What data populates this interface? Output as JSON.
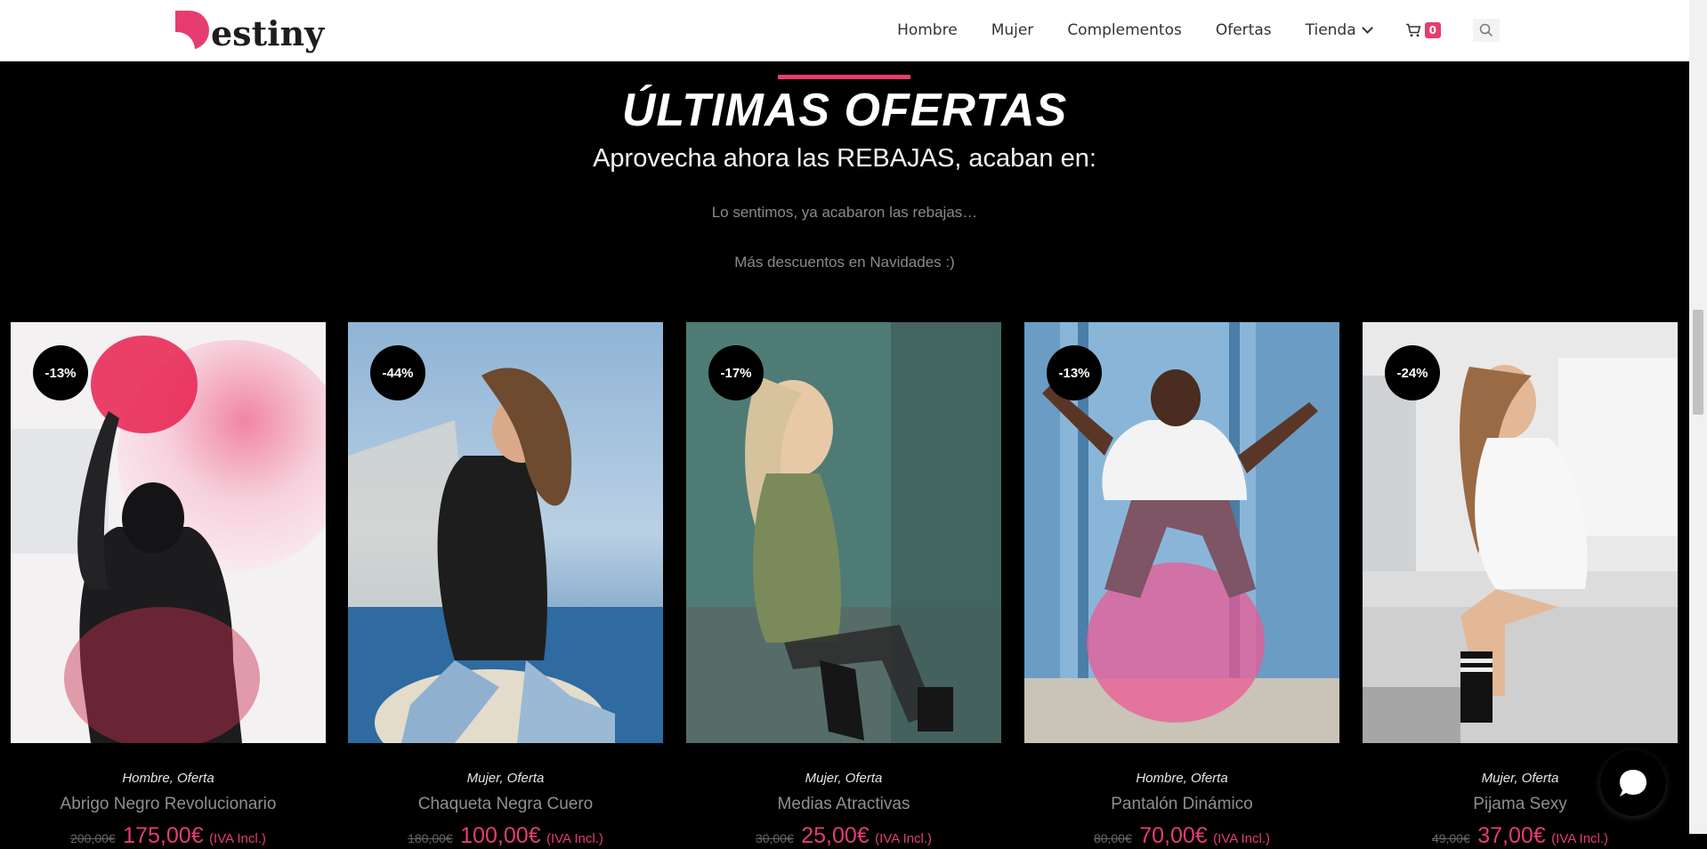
{
  "header": {
    "logo_text": "estiny",
    "nav": [
      "Hombre",
      "Mujer",
      "Complementos",
      "Ofertas",
      "Tienda"
    ],
    "cart_count": "0",
    "icons": [
      "cart-icon",
      "search-icon",
      "chevron-down-icon"
    ]
  },
  "section": {
    "title": "ÚLTIMAS OFERTAS",
    "subtitle": "Aprovecha ahora las REBAJAS, acaban en:",
    "note1": "Lo sentimos, ya acabaron las rebajas…",
    "note2": "Más descuentos en Navidades :)"
  },
  "products": [
    {
      "discount": "-13%",
      "categories": "Hombre, Oferta",
      "name": "Abrigo Negro Revolucionario",
      "old_price": "200,00€",
      "new_price": "175,00€",
      "tax": "(IVA Incl.)"
    },
    {
      "discount": "-44%",
      "categories": "Mujer, Oferta",
      "name": "Chaqueta Negra Cuero",
      "old_price": "180,00€",
      "new_price": "100,00€",
      "tax": "(IVA Incl.)"
    },
    {
      "discount": "-17%",
      "categories": "Mujer, Oferta",
      "name": "Medias Atractivas",
      "old_price": "30,00€",
      "new_price": "25,00€",
      "tax": "(IVA Incl.)"
    },
    {
      "discount": "-13%",
      "categories": "Hombre, Oferta",
      "name": "Pantalón Dinámico",
      "old_price": "80,00€",
      "new_price": "70,00€",
      "tax": "(IVA Incl.)"
    },
    {
      "discount": "-24%",
      "categories": "Mujer, Oferta",
      "name": "Pijama Sexy",
      "old_price": "49,00€",
      "new_price": "37,00€",
      "tax": "(IVA Incl.)"
    }
  ],
  "colors": {
    "accent": "#e73c6f",
    "background": "#000000"
  }
}
